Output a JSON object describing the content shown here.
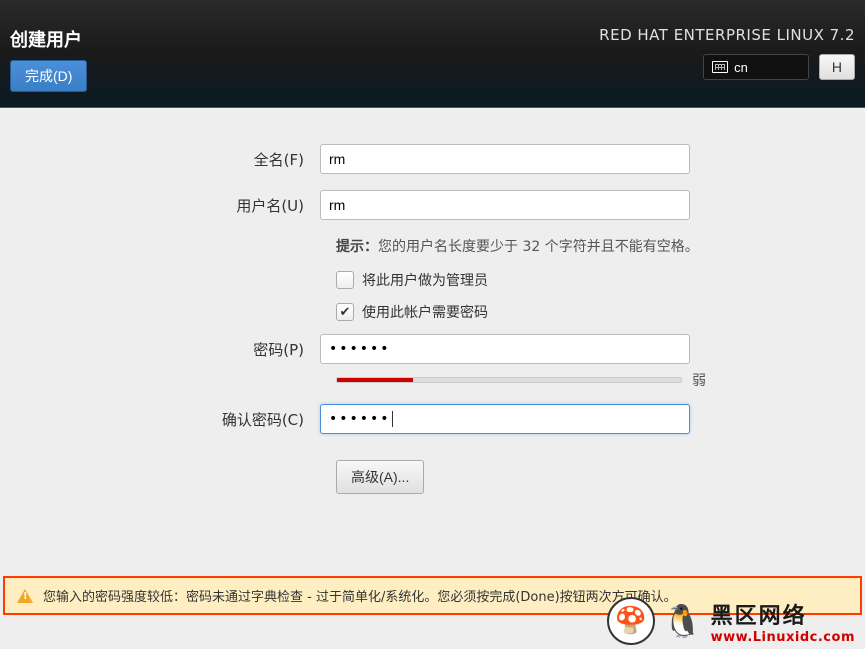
{
  "header": {
    "title": "创建用户",
    "done_label": "完成(D)",
    "os_label": "RED HAT ENTERPRISE LINUX 7.2",
    "lang_label": "cn",
    "help_label": "H"
  },
  "form": {
    "fullname_label": "全名(F)",
    "fullname_value": "rm",
    "username_label": "用户名(U)",
    "username_value": "rm",
    "hint_label": "提示：",
    "hint_text": "您的用户名长度要少于 32 个字符并且不能有空格。",
    "admin_checkbox_label": "将此用户做为管理员",
    "admin_checked": false,
    "require_pw_label": "使用此帐户需要密码",
    "require_pw_checked": true,
    "password_label": "密码(P)",
    "password_value": "••••••",
    "strength_label": "弱",
    "confirm_label": "确认密码(C)",
    "confirm_value": "••••••",
    "advanced_label": "高级(A)..."
  },
  "warning": {
    "text": "您输入的密码强度较低：密码未通过字典检查 - 过于简单化/系统化。您必须按完成(Done)按钮两次方可确认。"
  },
  "watermark": {
    "site_cn": "黑区网络",
    "site_url": "www.Linuxidc.com"
  }
}
